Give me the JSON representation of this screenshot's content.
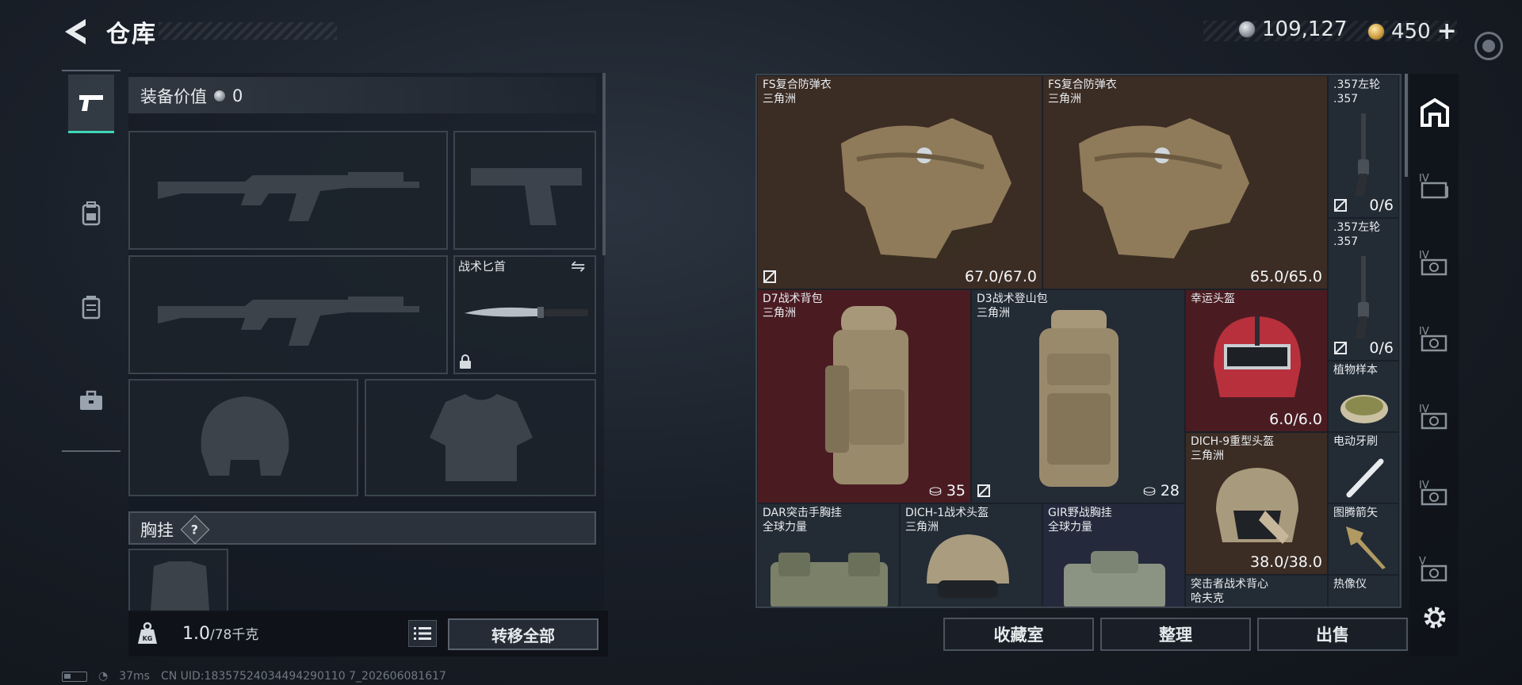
{
  "header": {
    "title": "仓库",
    "currency_silver": "109,127",
    "currency_gold": "450",
    "plus_label": "+"
  },
  "rail": {
    "tabs": [
      {
        "name": "weapons",
        "icon": "pistol-icon",
        "active": true
      },
      {
        "name": "gear",
        "icon": "backpack-icon",
        "active": false
      },
      {
        "name": "vest",
        "icon": "vest-icon",
        "active": false
      },
      {
        "name": "kit",
        "icon": "toolbox-icon",
        "active": false
      }
    ]
  },
  "equipment": {
    "value_label": "装备价值",
    "value": "0",
    "knife_label": "战术匕首",
    "chest_rig_label": "胸挂",
    "help_label": "?"
  },
  "bottom_left": {
    "weight_value": "1.0",
    "weight_max": "/78千克",
    "transfer_all_label": "转移全部"
  },
  "status": {
    "ping": "37ms",
    "uid": "CN UID:18357524034494290110 7_202606081617"
  },
  "stash": {
    "items": [
      {
        "id": "fs-vest-1",
        "name": "FS复合防弹衣",
        "sub": "三角洲",
        "value": "67.0/67.0"
      },
      {
        "id": "fs-vest-2",
        "name": "FS复合防弹衣",
        "sub": "三角洲",
        "value": "65.0/65.0"
      },
      {
        "id": "revolver-1",
        "name": ".357左轮",
        "sub": ".357",
        "value": "0/6"
      },
      {
        "id": "revolver-2",
        "name": ".357左轮",
        "sub": ".357",
        "value": "0/6"
      },
      {
        "id": "d7-backpack",
        "name": "D7战术背包",
        "sub": "三角洲",
        "value": "35"
      },
      {
        "id": "d3-backpack",
        "name": "D3战术登山包",
        "sub": "三角洲",
        "value": "28"
      },
      {
        "id": "lucky-helmet",
        "name": "幸运头盔",
        "sub": "",
        "value": "6.0/6.0"
      },
      {
        "id": "plant-sample",
        "name": "植物样本",
        "sub": "",
        "value": ""
      },
      {
        "id": "toothbrush",
        "name": "电动牙刷",
        "sub": "",
        "value": ""
      },
      {
        "id": "dich9-helmet",
        "name": "DICH-9重型头盔",
        "sub": "三角洲",
        "value": "38.0/38.0"
      },
      {
        "id": "totem-arrow",
        "name": "图腾箭矢",
        "sub": "",
        "value": ""
      },
      {
        "id": "dar-rig",
        "name": "DAR突击手胸挂",
        "sub": "全球力量",
        "value": ""
      },
      {
        "id": "dich1-helmet",
        "name": "DICH-1战术头盔",
        "sub": "三角洲",
        "value": ""
      },
      {
        "id": "gir-rig",
        "name": "GIR野战胸挂",
        "sub": "全球力量",
        "value": ""
      },
      {
        "id": "raider-vest",
        "name": "突击者战术背心",
        "sub": "哈夫克",
        "value": ""
      },
      {
        "id": "thermal",
        "name": "热像仪",
        "sub": "",
        "value": ""
      }
    ]
  },
  "stash_buttons": {
    "collection": "收藏室",
    "sort": "整理",
    "sell": "出售"
  },
  "right_rail": {
    "tabs": [
      "home-icon",
      "stash-tab-4-icon",
      "stash-tab-5-icon",
      "stash-tab-6-icon",
      "stash-tab-7-icon",
      "stash-tab-8-icon",
      "stash-tab-9-icon"
    ],
    "tab_labels": [
      "IV",
      "IV",
      "IV",
      "IV",
      "IV",
      "V"
    ]
  },
  "colors": {
    "accent": "#3fd6b6",
    "rarity_brown": "#3b2c24",
    "rarity_red": "#4a1c22",
    "rarity_navy": "#242a3c"
  }
}
